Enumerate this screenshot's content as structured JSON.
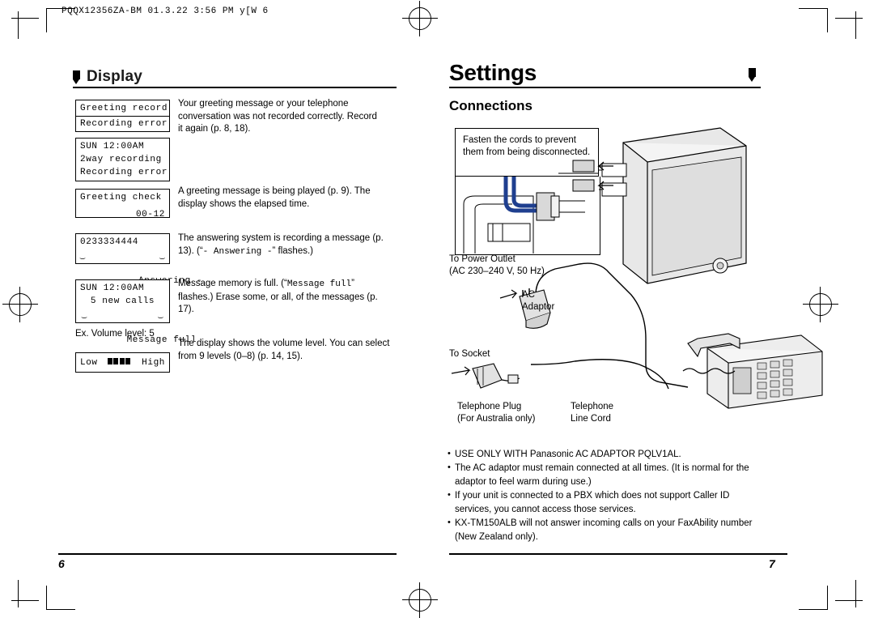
{
  "header_code": "PQQX12356ZA-BM 01.3.22 3:56 PM y[W 6",
  "left_page": {
    "section_title": "Display",
    "page_number": "6",
    "entries": [
      {
        "lcd": [
          {
            "text": "Greeting record",
            "align": "left",
            "divider": true
          },
          {
            "text": "Recording error",
            "align": "left"
          }
        ],
        "desc": "Your greeting message or your telephone conversation was not recorded correctly. Record it again (p. 8, 18)."
      },
      {
        "lcd": [
          {
            "text": "SUN 12:00AM",
            "align": "left"
          },
          {
            "text": "2way recording",
            "align": "left"
          },
          {
            "text": "Recording error",
            "align": "left"
          }
        ],
        "desc": ""
      },
      {
        "lcd": [
          {
            "text": "Greeting check",
            "align": "left"
          },
          {
            "text": "00-12",
            "align": "right"
          }
        ],
        "desc": "A greeting message is being played (p. 9). The display shows the elapsed time."
      },
      {
        "lcd": [
          {
            "text": "0233334444",
            "align": "left"
          },
          {
            "text": "- Answering -",
            "align": "center"
          }
        ],
        "desc_a": "The answering system is recording a message",
        "desc_b": "(p. 13). (“",
        "desc_mono": "- Answering -",
        "desc_c": "” flashes.)"
      },
      {
        "lcd": [
          {
            "text": "SUN 12:00AM",
            "align": "left"
          },
          {
            "text": "5 new calls",
            "align": "center"
          },
          {
            "text": "Message full",
            "align": "center"
          }
        ],
        "desc_a": "Message memory is full. (“",
        "desc_mono": "Message full",
        "desc_b": "” flashes.) Erase some, or all, of the messages (p. 17)."
      },
      {
        "example_label": "Ex. Volume level: 5",
        "lcd_volume": {
          "low": "Low",
          "high": "High",
          "bars": 4
        },
        "desc": "The display shows the volume level. You can select from 9 levels (0–8) (p. 14, 15)."
      }
    ]
  },
  "right_page": {
    "title": "Settings",
    "subtitle": "Connections",
    "page_number": "7",
    "callout": "Fasten the cords to prevent them from being disconnected.",
    "labels": {
      "power_outlet": "To Power Outlet",
      "power_outlet_spec": "(AC 230–240 V, 50 Hz)",
      "ac": "AC",
      "adaptor": "Adaptor",
      "to_socket": "To Socket",
      "telephone_plug": "Telephone Plug",
      "telephone_plug_note": "(For Australia only)",
      "telephone": "Telephone",
      "line_cord": "Line Cord"
    },
    "notes": [
      {
        "line1": "USE ONLY WITH Panasonic AC ADAPTOR PQLV1AL.",
        "line2": ""
      },
      {
        "line1": "The AC adaptor must remain connected at all times. (It is normal for the",
        "line2": "adaptor to feel warm during use.)"
      },
      {
        "line1": "If your unit is connected to a PBX which does not support Caller ID",
        "line2": "services, you cannot access those services."
      },
      {
        "line1": "KX-TM150ALB will not answer incoming calls on your FaxAbility number",
        "line2": "(New Zealand only)."
      }
    ]
  }
}
